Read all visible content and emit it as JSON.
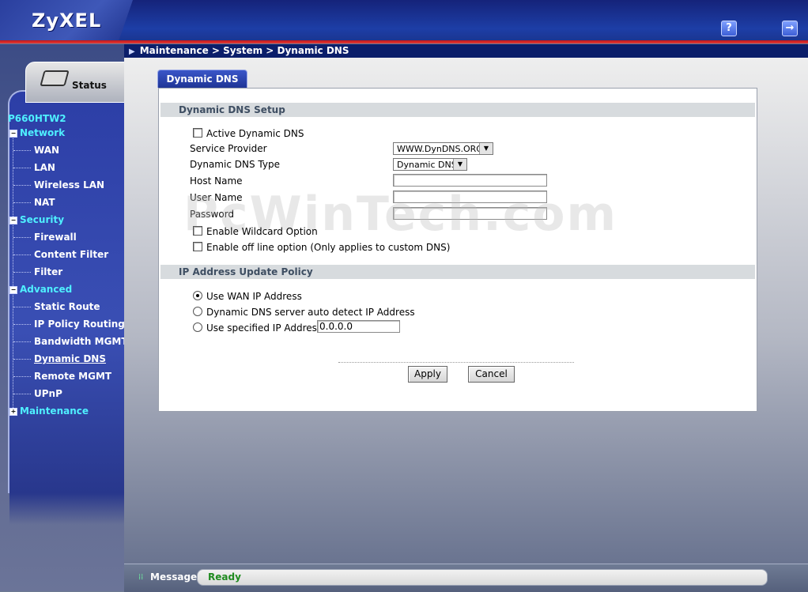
{
  "header": {
    "logo": "ZyXEL",
    "help_icon": "?",
    "logout_icon": "→",
    "breadcrumb": "Maintenance > System > Dynamic DNS"
  },
  "sidebar": {
    "status_label": "Status",
    "model": "P660HTW2",
    "groups": [
      {
        "label": "Network",
        "toggle": "−",
        "items": [
          "WAN",
          "LAN",
          "Wireless LAN",
          "NAT"
        ]
      },
      {
        "label": "Security",
        "toggle": "−",
        "items": [
          "Firewall",
          "Content Filter",
          "Filter"
        ]
      },
      {
        "label": "Advanced",
        "toggle": "−",
        "items": [
          "Static Route",
          "IP Policy Routing",
          "Bandwidth MGMT",
          "Dynamic DNS",
          "Remote MGMT",
          "UPnP"
        ]
      },
      {
        "label": "Maintenance",
        "toggle": "+",
        "items": []
      }
    ]
  },
  "main": {
    "tab": "Dynamic DNS",
    "setup": {
      "title": "Dynamic DNS Setup",
      "active_label": "Active Dynamic DNS",
      "active_checked": false,
      "service_provider_label": "Service Provider",
      "service_provider_value": "WWW.DynDNS.ORG",
      "ddns_type_label": "Dynamic DNS Type",
      "ddns_type_value": "Dynamic DNS",
      "host_name_label": "Host Name",
      "host_name_value": "",
      "user_name_label": "User Name",
      "user_name_value": "",
      "password_label": "Password",
      "password_value": "",
      "wildcard_label": "Enable Wildcard Option",
      "offline_label": "Enable off line option (Only applies to custom DNS)"
    },
    "policy": {
      "title": "IP Address Update Policy",
      "use_wan": "Use WAN IP Address",
      "auto_detect": "Dynamic DNS server auto detect IP Address",
      "specified": "Use specified IP Address",
      "specified_ip": "0.0.0.0",
      "selected": "use_wan"
    },
    "apply": "Apply",
    "cancel": "Cancel",
    "watermark": "PcWinTech.com"
  },
  "status": {
    "label": "Message",
    "text": "Ready"
  }
}
